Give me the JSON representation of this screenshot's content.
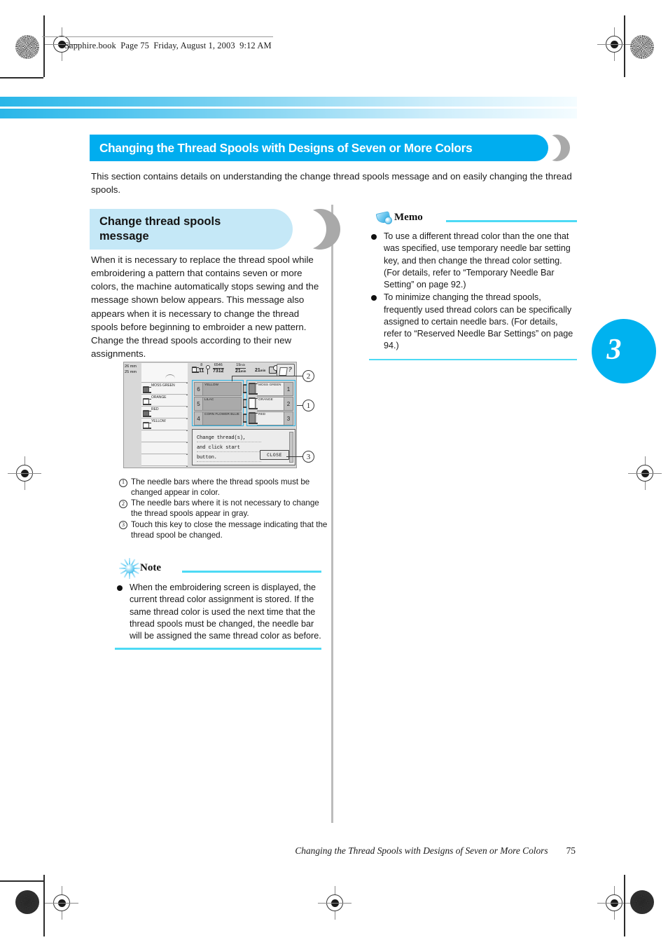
{
  "header": {
    "slug": "Sapphire.book  Page 75  Friday, August 1, 2003  9:12 AM"
  },
  "section": {
    "title": "Changing the Thread Spools with Designs of Seven or More Colors",
    "intro": "This section contains details on understanding the change thread spools message and on easily changing the thread spools."
  },
  "left_column": {
    "heading_line1": "Change thread spools",
    "heading_line2": "message",
    "body": "When it is necessary to replace the thread spool while embroidering a pattern that contains seven or more colors, the machine automatically stops sewing and the message shown below appears. This message also appears when it is necessary to change the thread spools before beginning to embroider a new pattern. Change the thread spools according to their new assignments."
  },
  "figure": {
    "mm_top": "26 mm",
    "mm_bottom": "25 mm",
    "status": {
      "stitch_num": "8",
      "stitch_den": "11",
      "count_num": "6546",
      "count_den": "7312",
      "time_num": "19",
      "time_num_unit": "min",
      "time_den": "21",
      "time_den_unit": "min",
      "time_total": "21",
      "time_total_unit": "min"
    },
    "thread_list": [
      {
        "name": "MOSS GREEN",
        "index": "1",
        "spool": "filled"
      },
      {
        "name": "ORANGE",
        "index": "2",
        "spool": "empty"
      },
      {
        "name": "RED",
        "index": "3",
        "spool": "filled"
      },
      {
        "name": "YELLOW",
        "index": "6",
        "spool": "empty"
      }
    ],
    "middle_panel": [
      {
        "num": "6",
        "name": "YELLOW"
      },
      {
        "num": "5",
        "name": "LILAC"
      },
      {
        "num": "4",
        "name": "CORN FLOWER BLUE"
      }
    ],
    "right_panel": [
      {
        "num": "1",
        "name": "MOSS GREEN",
        "spool": "filled"
      },
      {
        "num": "2",
        "name": "ORANGE",
        "spool": "empty"
      },
      {
        "num": "3",
        "name": "RED",
        "spool": "filled"
      }
    ],
    "message": {
      "line1": "Change thread(s),",
      "line2": "and click start",
      "line3": "button.",
      "close_label": "CLOSE"
    },
    "callouts": {
      "one": "1",
      "two": "2",
      "three": "3"
    }
  },
  "legend": [
    {
      "num": "1",
      "text": "The needle bars where the thread spools must be changed appear in color."
    },
    {
      "num": "2",
      "text": "The needle bars where it is not necessary to change the thread spools appear in gray."
    },
    {
      "num": "3",
      "text": "Touch this key to close the message indicating that the thread spool be changed."
    }
  ],
  "note": {
    "title": "Note",
    "items": [
      "When the embroidering screen is displayed, the current thread color assignment is stored. If the same thread color is used the next time that the thread spools must be changed, the needle bar will be assigned the same thread color as before."
    ]
  },
  "memo": {
    "title": "Memo",
    "items": [
      "To use a different thread color than the one that was specified, use temporary needle bar setting key, and then change the thread color setting. (For details, refer to “Temporary Needle Bar Setting” on page 92.)",
      "To minimize changing the thread spools, frequently used thread colors can be specifically assigned to certain needle bars. (For details, refer to “Reserved Needle Bar Settings” on page 94.)"
    ]
  },
  "chapter_tab": {
    "number": "3"
  },
  "footer": {
    "title": "Changing the Thread Spools with Designs of Seven or More Colors",
    "page": "75"
  },
  "colors": {
    "accent_cyan": "#00adef",
    "light_cyan": "#c5e8f7",
    "rule_cyan": "#4ddaf5",
    "gray_crescent": "#a9a9a9"
  }
}
